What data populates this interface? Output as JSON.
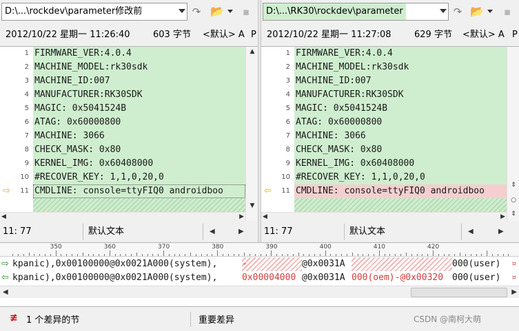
{
  "left": {
    "path": "D:\\...\\rockdev\\parameter修改前",
    "info": {
      "datetime": "2012/10/22 星期一 11:26:40",
      "size": "603 字节",
      "encoding": "<默认> A",
      "p_label": "P"
    },
    "status": {
      "position": "11: 77",
      "encoding": "默认文本"
    }
  },
  "right": {
    "path": "D:\\...\\RK30\\rockdev\\parameter",
    "info": {
      "datetime": "2012/10/22 星期一 11:27:08",
      "size": "629 字节",
      "encoding": "<默认> A",
      "p_label": "P"
    },
    "status": {
      "position": "11: 77",
      "encoding": "默认文本"
    }
  },
  "lines": [
    {
      "n": "1",
      "text": "FIRMWARE_VER:4.0.4"
    },
    {
      "n": "2",
      "text": "MACHINE_MODEL:rk30sdk"
    },
    {
      "n": "3",
      "text": "MACHINE_ID:007"
    },
    {
      "n": "4",
      "text": "MANUFACTURER:RK30SDK"
    },
    {
      "n": "5",
      "text": "MAGIC: 0x5041524B"
    },
    {
      "n": "6",
      "text": "ATAG: 0x60000800"
    },
    {
      "n": "7",
      "text": "MACHINE: 3066"
    },
    {
      "n": "8",
      "text": "CHECK_MASK: 0x80"
    },
    {
      "n": "9",
      "text": "KERNEL_IMG: 0x60408000"
    },
    {
      "n": "10",
      "text": "#RECOVER_KEY: 1,1,0,20,0"
    },
    {
      "n": "11",
      "text": "CMDLINE: console=ttyFIQ0 androidboo"
    }
  ],
  "ruler": {
    "labels": [
      "350",
      "360",
      "370",
      "380",
      "390",
      "400",
      "410",
      "420"
    ]
  },
  "compare": {
    "left_line": {
      "seg1": "kpanic),0x00100000@0x0021A000(system),",
      "seg2": "-",
      "seg3": "@0x0031A",
      "seg4": "000(user)"
    },
    "right_line": {
      "seg1": "kpanic),0x00100000@0x0021A000(system),",
      "seg2": "0x00004000",
      "seg3": "@0x0031A",
      "seg4": "000(oem)-@0x00320",
      "seg5": "000(user)"
    },
    "end_mark": "¤"
  },
  "bottom": {
    "diff_icon": "≢",
    "diff_count": "1 个差异的节",
    "major": "重要差异",
    "watermark": "CSDN @南柯大萌"
  },
  "icons": {
    "refresh": "↷",
    "folder": "📂",
    "save": "▪",
    "arrow_left_pane": "⇨",
    "arrow_right_pane": "⇦",
    "cmp_arrow_top": "⇨",
    "cmp_arrow_bottom": "⇦"
  },
  "colors": {
    "same_bg": "#cfeecf",
    "changed_bg": "#f5cfcf",
    "diff_text": "#d23b3b"
  }
}
